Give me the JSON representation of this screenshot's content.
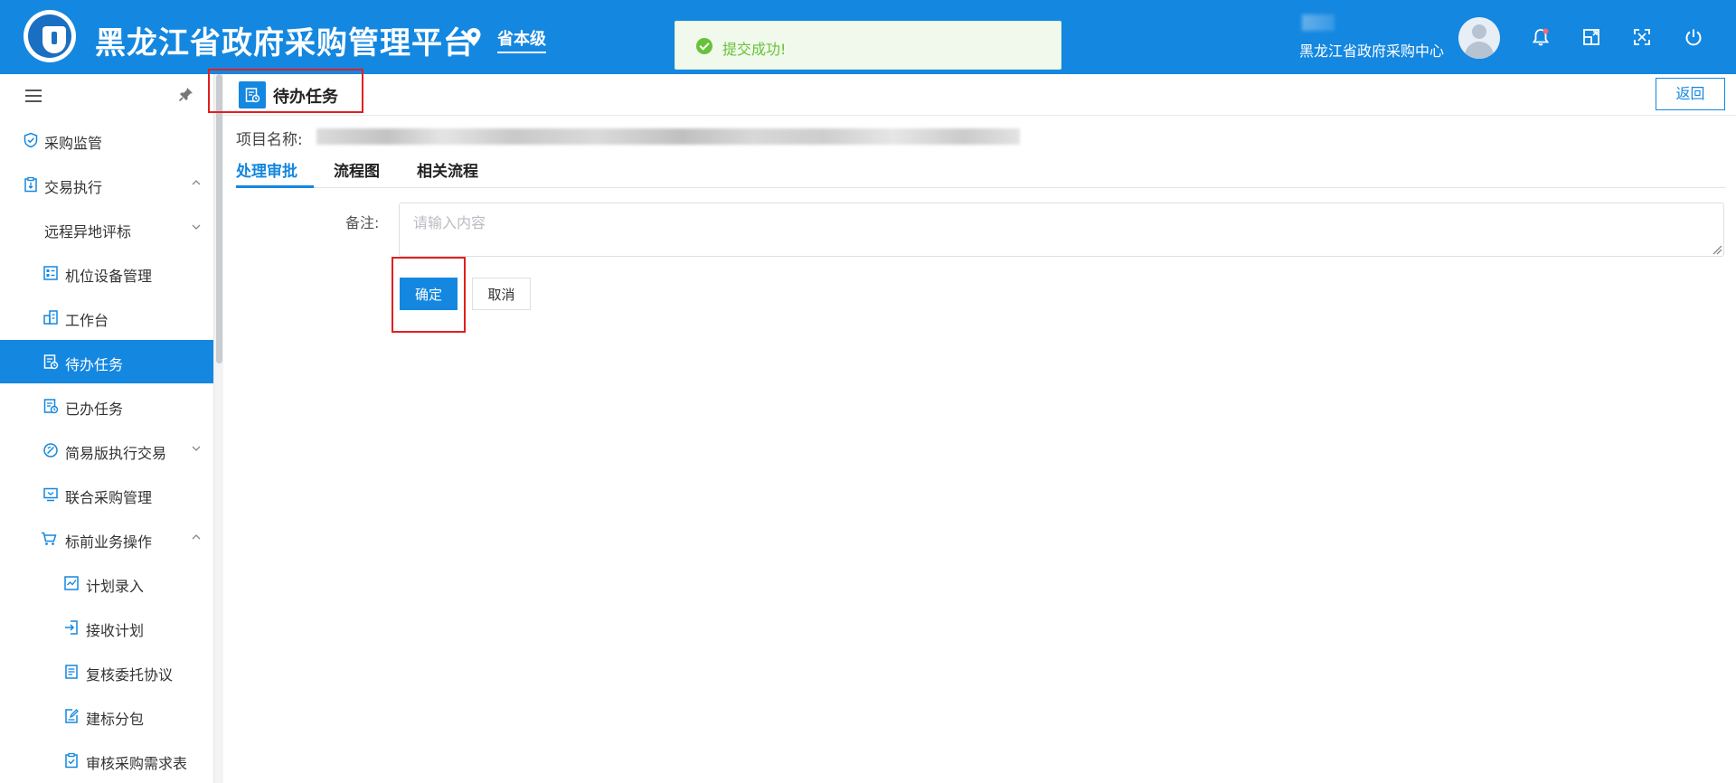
{
  "header": {
    "app_title": "黑龙江省政府采购管理平台",
    "region": "省本级",
    "user_name": "黑龙江省政府采购中心",
    "accent_color": "#1487e0",
    "icons": [
      "bell-icon",
      "window-icon",
      "fullscreen-icon",
      "power-icon"
    ]
  },
  "toast": {
    "message": "提交成功!",
    "status_color": "#67c23a"
  },
  "sidebar": {
    "items": [
      {
        "label": "采购监管",
        "icon": "shield-check-icon",
        "expandable": false
      },
      {
        "label": "交易执行",
        "icon": "clipboard-icon",
        "expandable": true,
        "expanded": true
      },
      {
        "label": "远程异地评标",
        "icon": "",
        "expandable": true,
        "expanded": false
      },
      {
        "label": "机位设备管理",
        "icon": "device-list-icon",
        "expandable": false
      },
      {
        "label": "工作台",
        "icon": "workbench-icon",
        "expandable": false
      },
      {
        "label": "待办任务",
        "icon": "todo-task-icon",
        "expandable": false,
        "active": true
      },
      {
        "label": "已办任务",
        "icon": "done-task-icon",
        "expandable": false
      },
      {
        "label": "简易版执行交易",
        "icon": "gauge-icon",
        "expandable": true,
        "expanded": false
      },
      {
        "label": "联合采购管理",
        "icon": "monitor-icon",
        "expandable": false
      },
      {
        "label": "标前业务操作",
        "icon": "cart-icon",
        "expandable": true,
        "expanded": true
      },
      {
        "label": "计划录入",
        "icon": "chart-check-icon",
        "expandable": false
      },
      {
        "label": "接收计划",
        "icon": "login-icon",
        "expandable": false
      },
      {
        "label": "复核委托协议",
        "icon": "document-icon",
        "expandable": false
      },
      {
        "label": "建标分包",
        "icon": "edit-doc-icon",
        "expandable": false
      },
      {
        "label": "审核采购需求表",
        "icon": "clipboard-check-icon",
        "expandable": false
      }
    ]
  },
  "page": {
    "title": "待办任务",
    "back_label": "返回",
    "project_label": "项目名称:",
    "tabs": [
      {
        "label": "处理审批",
        "active": true
      },
      {
        "label": "流程图",
        "active": false
      },
      {
        "label": "相关流程",
        "active": false
      }
    ],
    "form": {
      "remark_label": "备注:",
      "remark_placeholder": "请输入内容",
      "remark_value": "",
      "confirm_label": "确定",
      "cancel_label": "取消"
    }
  }
}
